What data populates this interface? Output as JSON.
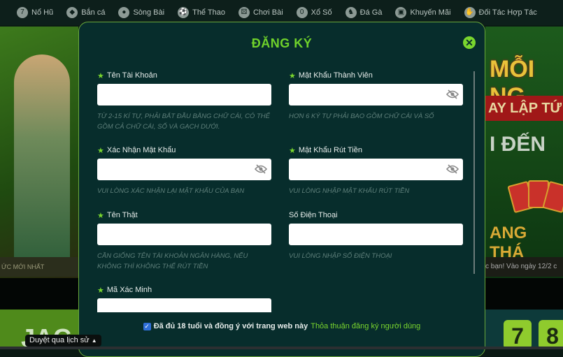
{
  "nav": {
    "items": [
      {
        "label": "Nổ Hũ",
        "icon": "slot-777-icon"
      },
      {
        "label": "Bắn cá",
        "icon": "fish-icon"
      },
      {
        "label": "Sòng Bài",
        "icon": "casino-chip-icon"
      },
      {
        "label": "Thể Thao",
        "icon": "soccer-ball-icon"
      },
      {
        "label": "Chơi Bài",
        "icon": "dice-icon"
      },
      {
        "label": "Xổ Số",
        "icon": "lottery-ball-icon"
      },
      {
        "label": "Đá Gà",
        "icon": "rooster-icon"
      },
      {
        "label": "Khuyến Mãi",
        "icon": "gift-icon"
      },
      {
        "label": "Đối Tác Hợp Tác",
        "icon": "handshake-icon"
      }
    ]
  },
  "background": {
    "left_strip": "ỨC MỚI NHẤT",
    "left_bottom": "JAC",
    "right_title": "MỖI NG",
    "right_red": "AY LẬP TỨ",
    "right_den": "I ĐẾN",
    "right_thang": "ANG THÁ",
    "right_strip": "c bạn! Vào ngày 12/2 c",
    "tiles": [
      "7",
      "8"
    ]
  },
  "modal": {
    "title": "ĐĂNG KÝ",
    "close": "✕",
    "fields": [
      {
        "label": "Tên Tài Khoản",
        "required": true,
        "hint": "Từ 2-15 kí tự, phải bắt đầu bằng chữ cái, có thể gồm cả chữ cái, số và gạch dưới.",
        "value": ""
      },
      {
        "label": "Mật Khẩu Thành Viên",
        "required": true,
        "hint": "Hơn 6 ký tự phải bao gồm chữ cái và số",
        "value": "",
        "icon": "eye-slash-icon"
      },
      {
        "label": "Xác Nhận Mật Khẩu",
        "required": true,
        "hint": "Vui lòng xác nhận lại mật khẩu của bạn",
        "value": "",
        "icon": "eye-slash-icon"
      },
      {
        "label": "Mật Khẩu Rút Tiền",
        "required": true,
        "hint": "Vui lòng nhập mật khẩu rút tiền",
        "value": "",
        "icon": "eye-slash-icon"
      },
      {
        "label": "Tên Thật",
        "required": true,
        "hint": "Cần giống tên tài khoản ngân hàng, nếu không thì không thể rút tiền",
        "value": ""
      },
      {
        "label": "Số Điện Thoại",
        "required": false,
        "hint": "Vui lòng nhập số điện thoại",
        "value": ""
      },
      {
        "label": "Mã Xác Minh",
        "required": true,
        "hint": "",
        "value": ""
      }
    ],
    "agree_checked": true,
    "agree_text": "Đã đủ 18 tuổi và đồng ý với trang web này",
    "agree_link": "Thỏa thuận đăng ký người dùng"
  },
  "tooltip": "Duyệt qua lịch sử",
  "colors": {
    "accent": "#7ad62e",
    "modal_bg": "#072d2c"
  }
}
